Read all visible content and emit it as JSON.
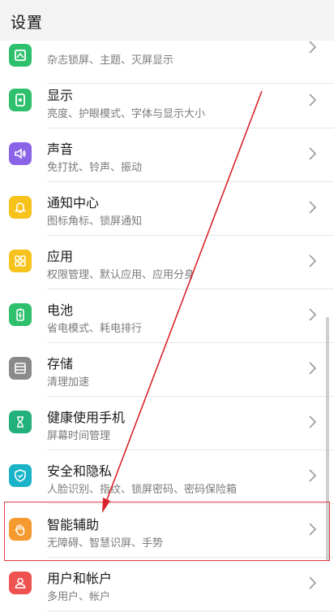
{
  "header": {
    "title": "设置"
  },
  "items": [
    {
      "title": "",
      "subtitle": "杂志锁屏、主题、灭屏显示",
      "icon": "theme-icon",
      "color": "#2ec06c"
    },
    {
      "title": "显示",
      "subtitle": "亮度、护眼模式、字体与显示大小",
      "icon": "display-icon",
      "color": "#2ec06c"
    },
    {
      "title": "声音",
      "subtitle": "免打扰、铃声、振动",
      "icon": "sound-icon",
      "color": "#8b63e6"
    },
    {
      "title": "通知中心",
      "subtitle": "图标角标、锁屏通知",
      "icon": "bell-icon",
      "color": "#f6c21b"
    },
    {
      "title": "应用",
      "subtitle": "权限管理、默认应用、应用分身",
      "icon": "apps-icon",
      "color": "#f6c21b"
    },
    {
      "title": "电池",
      "subtitle": "省电模式、耗电排行",
      "icon": "battery-icon",
      "color": "#2ec06c"
    },
    {
      "title": "存储",
      "subtitle": "清理加速",
      "icon": "storage-icon",
      "color": "#8a8a8a"
    },
    {
      "title": "健康使用手机",
      "subtitle": "屏幕时间管理",
      "icon": "hourglass-icon",
      "color": "#22b07c"
    },
    {
      "title": "安全和隐私",
      "subtitle": "人脸识别、指纹、锁屏密码、密码保险箱",
      "icon": "shield-icon",
      "color": "#19b4c8"
    },
    {
      "title": "智能辅助",
      "subtitle": "无障碍、智慧识屏、手势",
      "icon": "hand-icon",
      "color": "#f59a2e"
    },
    {
      "title": "用户和帐户",
      "subtitle": "多用户、帐户",
      "icon": "user-icon",
      "color": "#ef5350"
    }
  ]
}
